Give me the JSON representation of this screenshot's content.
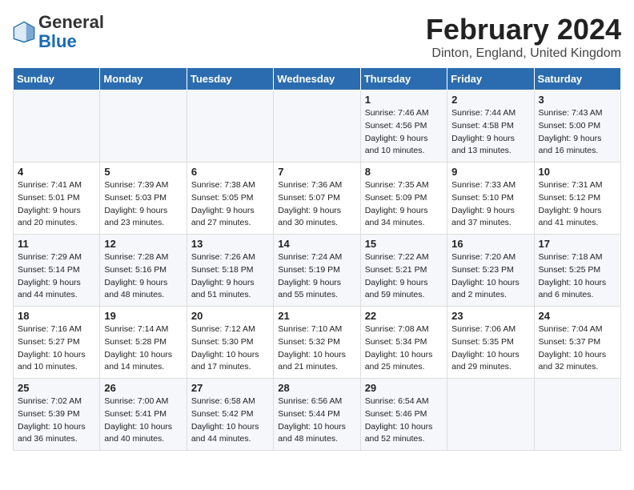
{
  "header": {
    "logo_general": "General",
    "logo_blue": "Blue",
    "title": "February 2024",
    "location": "Dinton, England, United Kingdom"
  },
  "days_of_week": [
    "Sunday",
    "Monday",
    "Tuesday",
    "Wednesday",
    "Thursday",
    "Friday",
    "Saturday"
  ],
  "weeks": [
    [
      {
        "day": "",
        "detail": ""
      },
      {
        "day": "",
        "detail": ""
      },
      {
        "day": "",
        "detail": ""
      },
      {
        "day": "",
        "detail": ""
      },
      {
        "day": "1",
        "detail": "Sunrise: 7:46 AM\nSunset: 4:56 PM\nDaylight: 9 hours\nand 10 minutes."
      },
      {
        "day": "2",
        "detail": "Sunrise: 7:44 AM\nSunset: 4:58 PM\nDaylight: 9 hours\nand 13 minutes."
      },
      {
        "day": "3",
        "detail": "Sunrise: 7:43 AM\nSunset: 5:00 PM\nDaylight: 9 hours\nand 16 minutes."
      }
    ],
    [
      {
        "day": "4",
        "detail": "Sunrise: 7:41 AM\nSunset: 5:01 PM\nDaylight: 9 hours\nand 20 minutes."
      },
      {
        "day": "5",
        "detail": "Sunrise: 7:39 AM\nSunset: 5:03 PM\nDaylight: 9 hours\nand 23 minutes."
      },
      {
        "day": "6",
        "detail": "Sunrise: 7:38 AM\nSunset: 5:05 PM\nDaylight: 9 hours\nand 27 minutes."
      },
      {
        "day": "7",
        "detail": "Sunrise: 7:36 AM\nSunset: 5:07 PM\nDaylight: 9 hours\nand 30 minutes."
      },
      {
        "day": "8",
        "detail": "Sunrise: 7:35 AM\nSunset: 5:09 PM\nDaylight: 9 hours\nand 34 minutes."
      },
      {
        "day": "9",
        "detail": "Sunrise: 7:33 AM\nSunset: 5:10 PM\nDaylight: 9 hours\nand 37 minutes."
      },
      {
        "day": "10",
        "detail": "Sunrise: 7:31 AM\nSunset: 5:12 PM\nDaylight: 9 hours\nand 41 minutes."
      }
    ],
    [
      {
        "day": "11",
        "detail": "Sunrise: 7:29 AM\nSunset: 5:14 PM\nDaylight: 9 hours\nand 44 minutes."
      },
      {
        "day": "12",
        "detail": "Sunrise: 7:28 AM\nSunset: 5:16 PM\nDaylight: 9 hours\nand 48 minutes."
      },
      {
        "day": "13",
        "detail": "Sunrise: 7:26 AM\nSunset: 5:18 PM\nDaylight: 9 hours\nand 51 minutes."
      },
      {
        "day": "14",
        "detail": "Sunrise: 7:24 AM\nSunset: 5:19 PM\nDaylight: 9 hours\nand 55 minutes."
      },
      {
        "day": "15",
        "detail": "Sunrise: 7:22 AM\nSunset: 5:21 PM\nDaylight: 9 hours\nand 59 minutes."
      },
      {
        "day": "16",
        "detail": "Sunrise: 7:20 AM\nSunset: 5:23 PM\nDaylight: 10 hours\nand 2 minutes."
      },
      {
        "day": "17",
        "detail": "Sunrise: 7:18 AM\nSunset: 5:25 PM\nDaylight: 10 hours\nand 6 minutes."
      }
    ],
    [
      {
        "day": "18",
        "detail": "Sunrise: 7:16 AM\nSunset: 5:27 PM\nDaylight: 10 hours\nand 10 minutes."
      },
      {
        "day": "19",
        "detail": "Sunrise: 7:14 AM\nSunset: 5:28 PM\nDaylight: 10 hours\nand 14 minutes."
      },
      {
        "day": "20",
        "detail": "Sunrise: 7:12 AM\nSunset: 5:30 PM\nDaylight: 10 hours\nand 17 minutes."
      },
      {
        "day": "21",
        "detail": "Sunrise: 7:10 AM\nSunset: 5:32 PM\nDaylight: 10 hours\nand 21 minutes."
      },
      {
        "day": "22",
        "detail": "Sunrise: 7:08 AM\nSunset: 5:34 PM\nDaylight: 10 hours\nand 25 minutes."
      },
      {
        "day": "23",
        "detail": "Sunrise: 7:06 AM\nSunset: 5:35 PM\nDaylight: 10 hours\nand 29 minutes."
      },
      {
        "day": "24",
        "detail": "Sunrise: 7:04 AM\nSunset: 5:37 PM\nDaylight: 10 hours\nand 32 minutes."
      }
    ],
    [
      {
        "day": "25",
        "detail": "Sunrise: 7:02 AM\nSunset: 5:39 PM\nDaylight: 10 hours\nand 36 minutes."
      },
      {
        "day": "26",
        "detail": "Sunrise: 7:00 AM\nSunset: 5:41 PM\nDaylight: 10 hours\nand 40 minutes."
      },
      {
        "day": "27",
        "detail": "Sunrise: 6:58 AM\nSunset: 5:42 PM\nDaylight: 10 hours\nand 44 minutes."
      },
      {
        "day": "28",
        "detail": "Sunrise: 6:56 AM\nSunset: 5:44 PM\nDaylight: 10 hours\nand 48 minutes."
      },
      {
        "day": "29",
        "detail": "Sunrise: 6:54 AM\nSunset: 5:46 PM\nDaylight: 10 hours\nand 52 minutes."
      },
      {
        "day": "",
        "detail": ""
      },
      {
        "day": "",
        "detail": ""
      }
    ]
  ]
}
